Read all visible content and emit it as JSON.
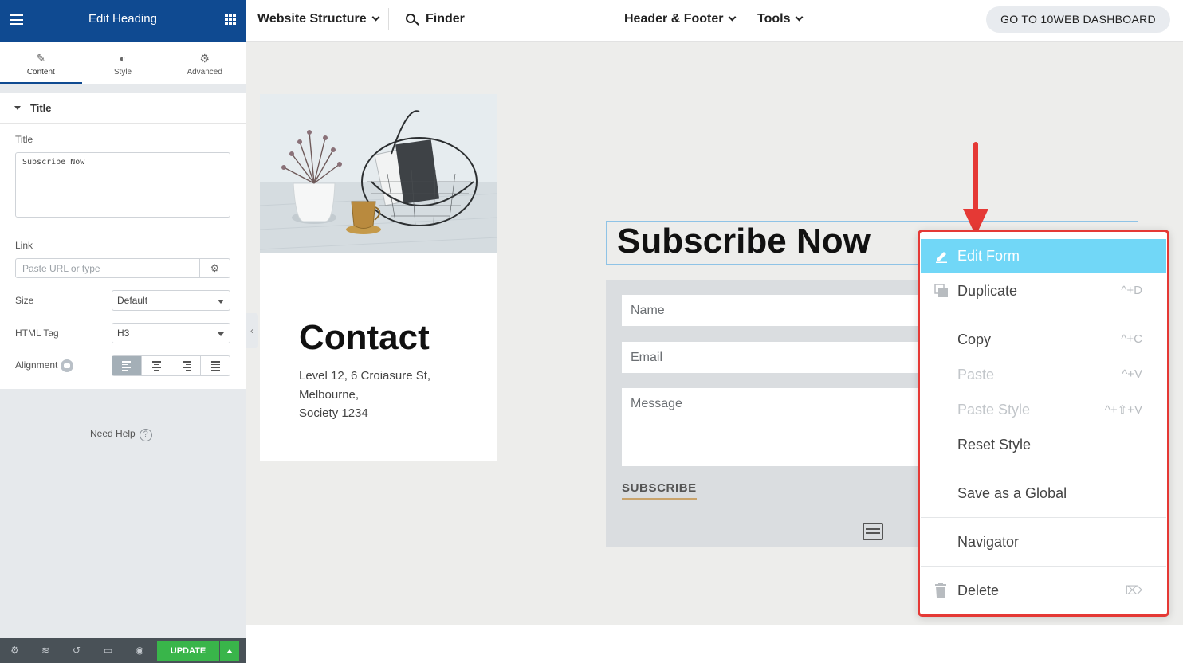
{
  "panel": {
    "title": "Edit Heading",
    "tabs": [
      {
        "label": "Content",
        "icon": "pencil-icon"
      },
      {
        "label": "Style",
        "icon": "half-circle-icon"
      },
      {
        "label": "Advanced",
        "icon": "gear-icon"
      }
    ],
    "section_title": "Title",
    "title_label": "Title",
    "title_value": "Subscribe Now",
    "link_label": "Link",
    "link_placeholder": "Paste URL or type",
    "size_label": "Size",
    "size_value": "Default",
    "html_tag_label": "HTML Tag",
    "html_tag_value": "H3",
    "alignment_label": "Alignment",
    "need_help": "Need Help",
    "update_label": "UPDATE"
  },
  "topbar": {
    "website_structure": "Website Structure",
    "finder": "Finder",
    "header_footer": "Header & Footer",
    "tools": "Tools",
    "dashboard_button": "GO TO 10WEB DASHBOARD"
  },
  "canvas": {
    "contact_heading": "Contact",
    "contact_address": [
      "Level 12, 6 Croiasure St,",
      "Melbourne,",
      "Society 1234"
    ],
    "subscribe_heading": "Subscribe Now",
    "form": {
      "name_placeholder": "Name",
      "email_placeholder": "Email",
      "message_placeholder": "Message",
      "submit_label": "SUBSCRIBE"
    }
  },
  "context_menu": {
    "items": [
      {
        "label": "Edit Form",
        "shortcut": "",
        "highlighted": true
      },
      {
        "label": "Duplicate",
        "shortcut": "^+D"
      },
      {
        "label": "Copy",
        "shortcut": "^+C"
      },
      {
        "label": "Paste",
        "shortcut": "^+V",
        "disabled": true
      },
      {
        "label": "Paste Style",
        "shortcut": "^+⇧+V",
        "disabled": true
      },
      {
        "label": "Reset Style",
        "shortcut": ""
      },
      {
        "label": "Save as a Global",
        "shortcut": ""
      },
      {
        "label": "Navigator",
        "shortcut": ""
      },
      {
        "label": "Delete",
        "shortcut": "⌦"
      }
    ]
  },
  "colors": {
    "panel_header": "#0f4a91",
    "menu_highlight": "#71d7f7",
    "annotation_red": "#e53935",
    "update_green": "#39b54a"
  }
}
